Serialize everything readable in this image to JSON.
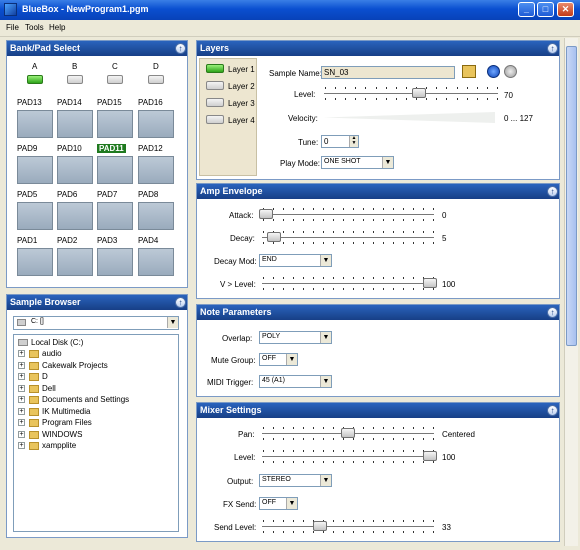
{
  "window": {
    "title": "BlueBox - NewProgram1.pgm",
    "min": "_",
    "max": "□",
    "close": "✕"
  },
  "menu": [
    "File",
    "Tools",
    "Help"
  ],
  "bank": {
    "title": "Bank/Pad Select",
    "banks": [
      {
        "label": "A",
        "on": true
      },
      {
        "label": "B",
        "on": false
      },
      {
        "label": "C",
        "on": false
      },
      {
        "label": "D",
        "on": false
      }
    ],
    "pad_rows": [
      [
        "PAD13",
        "PAD14",
        "PAD15",
        "PAD16"
      ],
      [
        "PAD9",
        "PAD10",
        "PAD11",
        "PAD12"
      ],
      [
        "PAD5",
        "PAD6",
        "PAD7",
        "PAD8"
      ],
      [
        "PAD1",
        "PAD2",
        "PAD3",
        "PAD4"
      ]
    ],
    "selected_pad": "PAD11"
  },
  "browser": {
    "title": "Sample Browser",
    "drive": "C: []",
    "root": "Local Disk (C:)",
    "folders": [
      "audio",
      "Cakewalk Projects",
      "D",
      "Dell",
      "Documents and Settings",
      "IK Multimedia",
      "Program Files",
      "WINDOWS",
      "xampplite"
    ]
  },
  "layers": {
    "title": "Layers",
    "items": [
      {
        "label": "Layer 1",
        "on": true
      },
      {
        "label": "Layer 2",
        "on": false
      },
      {
        "label": "Layer 3",
        "on": false
      },
      {
        "label": "Layer 4",
        "on": false
      }
    ],
    "sample_name_label": "Sample Name:",
    "sample_name": "SN_03",
    "level_label": "Level:",
    "level_value": "70",
    "level_frac": 0.55,
    "velocity_label": "Velocity:",
    "velocity_value": "0 ... 127",
    "tune_label": "Tune:",
    "tune_value": "0",
    "playmode_label": "Play Mode:",
    "playmode_value": "ONE SHOT"
  },
  "amp": {
    "title": "Amp Envelope",
    "attack_label": "Attack:",
    "attack_value": "0",
    "attack_frac": 0.0,
    "decay_label": "Decay:",
    "decay_value": "5",
    "decay_frac": 0.05,
    "decaymod_label": "Decay Mod:",
    "decaymod_value": "END",
    "vlevel_label": "V > Level:",
    "vlevel_value": "100",
    "vlevel_frac": 1.0
  },
  "note": {
    "title": "Note Parameters",
    "overlap_label": "Overlap:",
    "overlap_value": "POLY",
    "mute_label": "Mute Group:",
    "mute_value": "OFF",
    "midi_label": "MIDI Trigger:",
    "midi_value": "45 (A1)"
  },
  "mixer": {
    "title": "Mixer Settings",
    "pan_label": "Pan:",
    "pan_value": "Centered",
    "pan_frac": 0.5,
    "level_label": "Level:",
    "level_value": "100",
    "level_frac": 1.0,
    "output_label": "Output:",
    "output_value": "STEREO",
    "fxsend_label": "FX Send:",
    "fxsend_value": "OFF",
    "sendlevel_label": "Send Level:",
    "sendlevel_value": "33",
    "sendlevel_frac": 0.33
  }
}
